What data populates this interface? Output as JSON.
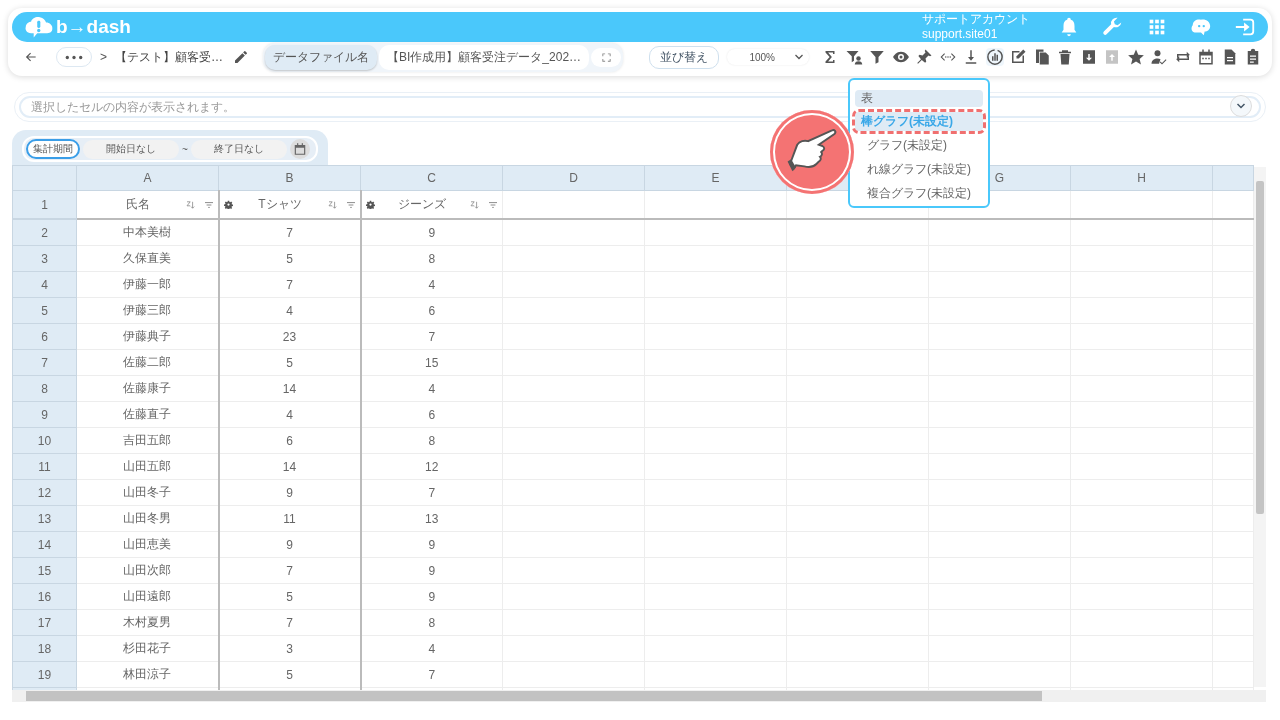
{
  "app": {
    "logo": "b→dash",
    "account_name": "サポートアカウント",
    "account_id": "support.site01"
  },
  "breadcrumb": {
    "separator": ">",
    "title": "【テスト】顧客受…"
  },
  "data_file": {
    "label": "データファイル名",
    "value": "【BI作成用】顧客受注データ_202…"
  },
  "sort_button": "並び替え",
  "zoom": "100%",
  "toolbar_buttons": [
    {
      "disabled": false,
      "active": false
    },
    {
      "disabled": false,
      "active": false
    },
    {
      "disabled": false,
      "active": false
    },
    {
      "disabled": false,
      "active": false
    },
    {
      "disabled": false,
      "active": false
    },
    {
      "disabled": false,
      "active": false
    },
    {
      "disabled": false,
      "active": false
    },
    {
      "disabled": false,
      "active": true
    },
    {
      "disabled": false,
      "active": false
    },
    {
      "disabled": false,
      "active": false
    },
    {
      "disabled": false,
      "active": false
    },
    {
      "disabled": false,
      "active": false
    },
    {
      "disabled": true,
      "active": false
    },
    {
      "disabled": false,
      "active": false
    },
    {
      "disabled": false,
      "active": false
    },
    {
      "disabled": false,
      "active": false
    },
    {
      "disabled": false,
      "active": false
    },
    {
      "disabled": false,
      "active": false
    },
    {
      "disabled": false,
      "active": false
    }
  ],
  "cell_content": {
    "placeholder": "選択したセルの内容が表示されます。"
  },
  "period": {
    "label": "集計期間",
    "start": "開始日なし",
    "separator": "~",
    "end": "終了日なし"
  },
  "grid": {
    "columns": [
      {
        "label": "A"
      },
      {
        "label": "B"
      },
      {
        "label": "C"
      },
      {
        "label": "D"
      },
      {
        "label": "E"
      },
      {},
      {
        "label": "G"
      },
      {
        "label": "H"
      }
    ],
    "header_row": {
      "number": "1",
      "cells": [
        {
          "text": "氏名",
          "settings": false
        },
        {
          "text": "Tシャツ",
          "settings": true
        },
        {
          "text": "ジーンズ",
          "settings": true
        }
      ]
    },
    "rows": [
      {
        "number": "2",
        "cells": [
          "中本美樹",
          "7",
          "9"
        ]
      },
      {
        "number": "3",
        "cells": [
          "久保直美",
          "5",
          "8"
        ]
      },
      {
        "number": "4",
        "cells": [
          "伊藤一郎",
          "7",
          "4"
        ]
      },
      {
        "number": "5",
        "cells": [
          "伊藤三郎",
          "4",
          "6"
        ]
      },
      {
        "number": "6",
        "cells": [
          "伊藤典子",
          "23",
          "7"
        ]
      },
      {
        "number": "7",
        "cells": [
          "佐藤二郎",
          "5",
          "15"
        ]
      },
      {
        "number": "8",
        "cells": [
          "佐藤康子",
          "14",
          "4"
        ]
      },
      {
        "number": "9",
        "cells": [
          "佐藤直子",
          "4",
          "6"
        ]
      },
      {
        "number": "10",
        "cells": [
          "吉田五郎",
          "6",
          "8"
        ]
      },
      {
        "number": "11",
        "cells": [
          "山田五郎",
          "14",
          "12"
        ]
      },
      {
        "number": "12",
        "cells": [
          "山田冬子",
          "9",
          "7"
        ]
      },
      {
        "number": "13",
        "cells": [
          "山田冬男",
          "11",
          "13"
        ]
      },
      {
        "number": "14",
        "cells": [
          "山田恵美",
          "9",
          "9"
        ]
      },
      {
        "number": "15",
        "cells": [
          "山田次郎",
          "7",
          "9"
        ]
      },
      {
        "number": "16",
        "cells": [
          "山田遠郎",
          "5",
          "9"
        ]
      },
      {
        "number": "17",
        "cells": [
          "木村夏男",
          "7",
          "8"
        ]
      },
      {
        "number": "18",
        "cells": [
          "杉田花子",
          "3",
          "4"
        ]
      },
      {
        "number": "19",
        "cells": [
          "林田涼子",
          "5",
          "7"
        ]
      }
    ]
  },
  "chart_menu": {
    "items": [
      {
        "label": "表",
        "kind": "header",
        "selected": false
      },
      {
        "label": "棒グラフ(未設定)",
        "kind": "option",
        "selected": true
      },
      {
        "label": "グラフ(未設定)",
        "kind": "option",
        "selected": false
      },
      {
        "label": "れ線グラフ(未設定)",
        "kind": "option",
        "selected": false
      },
      {
        "label": "複合グラフ(未設定)",
        "kind": "option",
        "selected": false
      }
    ]
  }
}
